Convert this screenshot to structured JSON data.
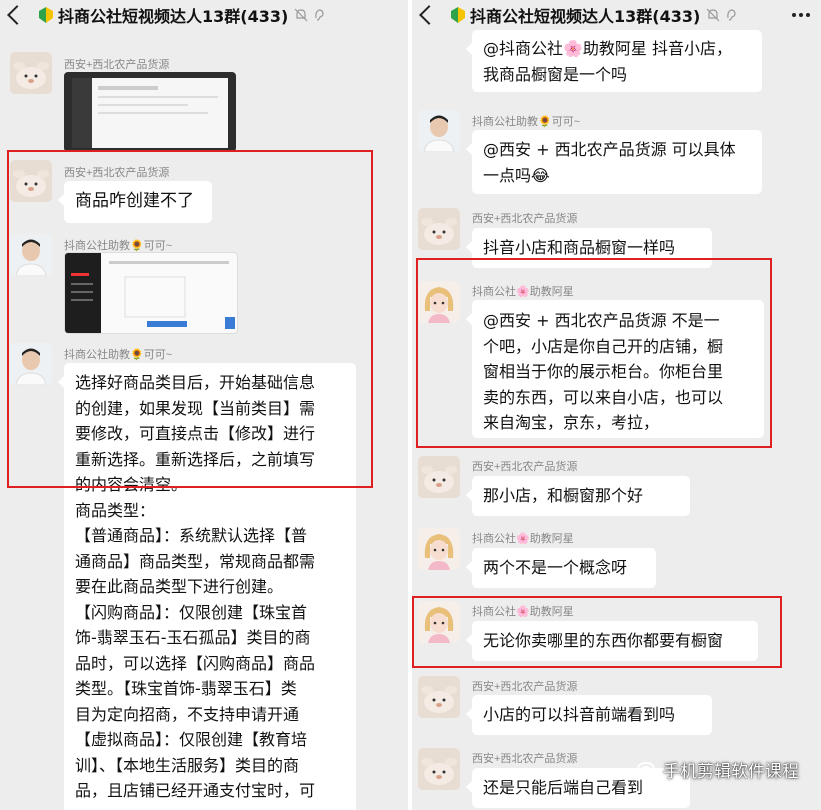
{
  "app": {
    "chat_title": "抖商公社短视频达人13群(433)"
  },
  "left": {
    "messages": [
      {
        "sender": "西安+西北农产品货源",
        "type": "image"
      },
      {
        "sender": "西安+西北农产品货源",
        "text": "商品咋创建不了"
      },
      {
        "sender": "抖商公社助教🌻可可~",
        "type": "image"
      },
      {
        "sender": "抖商公社助教🌻可可~",
        "lines": [
          "选择好商品类目后，开始基础信息",
          "的创建，如果发现【当前类目】需",
          "要修改，可直接点击【修改】进行",
          "重新选择。重新选择后，之前填写",
          "的内容会清空。",
          "商品类型：",
          "【普通商品】：系统默认选择【普",
          "通商品】商品类型，常规商品都需",
          "要在此商品类型下进行创建。",
          "【闪购商品】：仅限创建【珠宝首",
          "饰-翡翠玉石-玉石孤品】类目的商",
          "品时，可以选择【闪购商品】商品",
          "类型。【珠宝首饰-翡翠玉石】类",
          "目为定向招商，不支持申请开通",
          "【虚拟商品】：仅限创建【教育培",
          "训】、【本地生活服务】类目的商",
          "品，且店铺已经开通支付宝时，可"
        ]
      }
    ]
  },
  "right": {
    "messages": [
      {
        "sender": "",
        "lines": [
          "@抖商公社🌸助教阿星  抖音小店，",
          "我商品橱窗是一个吗"
        ]
      },
      {
        "sender": "抖商公社助教🌻可可~",
        "lines": [
          "@西安 + 西北农产品货源 可以具体",
          "一点吗😂"
        ]
      },
      {
        "sender": "西安+西北农产品货源",
        "text": "抖音小店和商品橱窗一样吗"
      },
      {
        "sender": "抖商公社🌸助教阿星",
        "lines": [
          "@西安 + 西北农产品货源  不是一",
          "个吧，小店是你自己开的店铺，橱",
          "窗相当于你的展示柜台。你柜台里",
          "卖的东西，可以来自小店，也可以",
          "来自淘宝，京东，考拉，"
        ]
      },
      {
        "sender": "西安+西北农产品货源",
        "text": "那小店，和橱窗那个好"
      },
      {
        "sender": "抖商公社🌸助教阿星",
        "text": "两个不是一个概念呀"
      },
      {
        "sender": "抖商公社🌸助教阿星",
        "text": "无论你卖哪里的东西你都要有橱窗"
      },
      {
        "sender": "西安+西北农产品货源",
        "text": "小店的可以抖音前端看到吗"
      },
      {
        "sender": "西安+西北农产品货源",
        "text": "还是只能后端自己看到"
      }
    ]
  },
  "watermark": {
    "text": "手机剪辑软件课程",
    "icon": "wechat-channel-icon"
  },
  "colors": {
    "highlight_box": "#e02020",
    "chat_bg": "#ededed",
    "bubble": "#ffffff"
  }
}
